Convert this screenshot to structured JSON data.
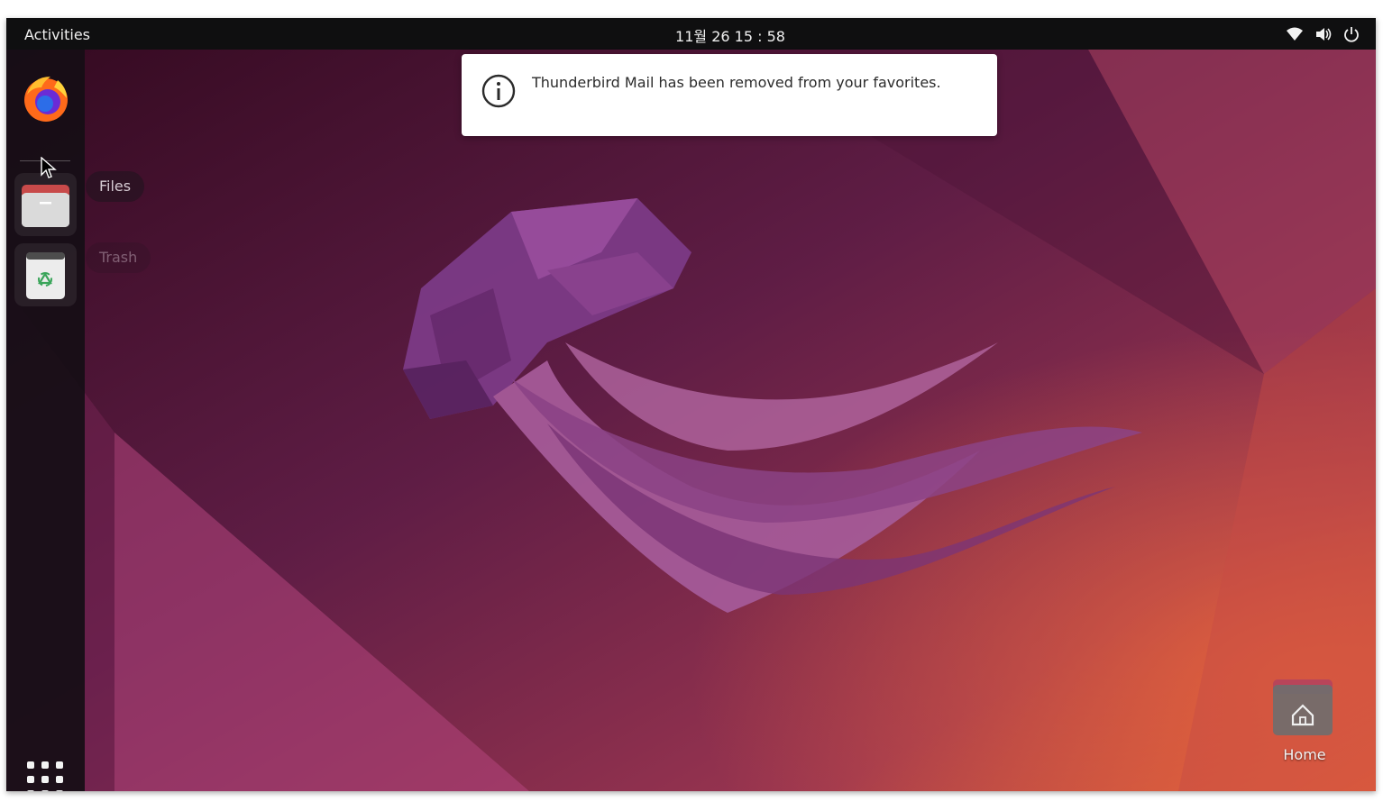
{
  "topbar": {
    "activities_label": "Activities",
    "clock": "11월 26  15 : 58",
    "tray_icons": [
      "wifi-icon",
      "volume-icon",
      "power-icon"
    ]
  },
  "dock": {
    "apps": [
      {
        "name": "Firefox",
        "icon": "firefox-icon"
      },
      {
        "name": "Files",
        "icon": "files-icon",
        "tooltip": "Files"
      },
      {
        "name": "Trash",
        "icon": "trash-icon",
        "tooltip": "Trash"
      }
    ],
    "show_apps_icon": "apps-grid-icon"
  },
  "notification": {
    "icon": "info-icon",
    "message": "Thunderbird Mail has been removed from your favorites."
  },
  "desktop": {
    "home_label": "Home",
    "home_icon": "home-folder-icon"
  },
  "colors": {
    "topbar": "#0f0f10",
    "accent": "#e95420",
    "wallpaper_dark": "#3d1030",
    "wallpaper_orange": "#d2553a"
  }
}
